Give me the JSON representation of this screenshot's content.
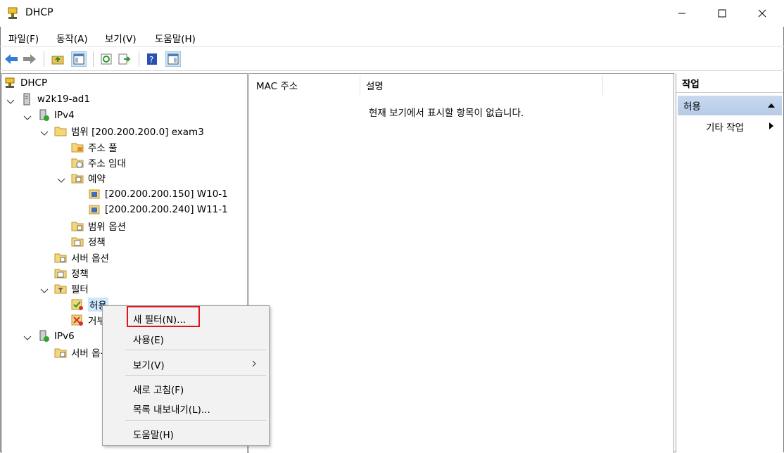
{
  "window": {
    "title": "DHCP"
  },
  "menu": [
    "파일(F)",
    "동작(A)",
    "보기(V)",
    "도움말(H)"
  ],
  "toolbar": [
    "back-icon",
    "forward-icon",
    "up-folder-icon",
    "show-hide-tree-icon",
    "refresh-icon",
    "export-list-icon",
    "help-icon",
    "show-hide-action-icon"
  ],
  "tree": {
    "root": "DHCP",
    "server": "w2k19-ad1",
    "ipv4": "IPv4",
    "scope": "범위 [200.200.200.0] exam3",
    "address_pool": "주소 풀",
    "address_leases": "주소 임대",
    "reservations": "예약",
    "res1": "[200.200.200.150] W10-1",
    "res2": "[200.200.200.240] W11-1",
    "scope_options": "범위 옵션",
    "scope_policies": "정책",
    "server_options": "서버 옵션",
    "policies": "정책",
    "filters": "필터",
    "allow": "허용",
    "deny": "거부",
    "ipv6": "IPv6",
    "ipv6_server_options": "서버 옵션"
  },
  "list": {
    "col_mac": "MAC 주소",
    "col_desc": "설명",
    "empty": "현재 보기에서 표시할 항목이 없습니다."
  },
  "actions": {
    "title": "작업",
    "section": "허용",
    "more": "기타 작업"
  },
  "context_menu": {
    "new_filter": "새 필터(N)...",
    "enable": "사용(E)",
    "view": "보기(V)",
    "refresh": "새로 고침(F)",
    "export": "목록 내보내기(L)...",
    "help": "도움말(H)"
  },
  "colors": {
    "highlight_box": "#e0151b",
    "selection": "#cce8ff",
    "action_section": "#c0d3ec"
  }
}
